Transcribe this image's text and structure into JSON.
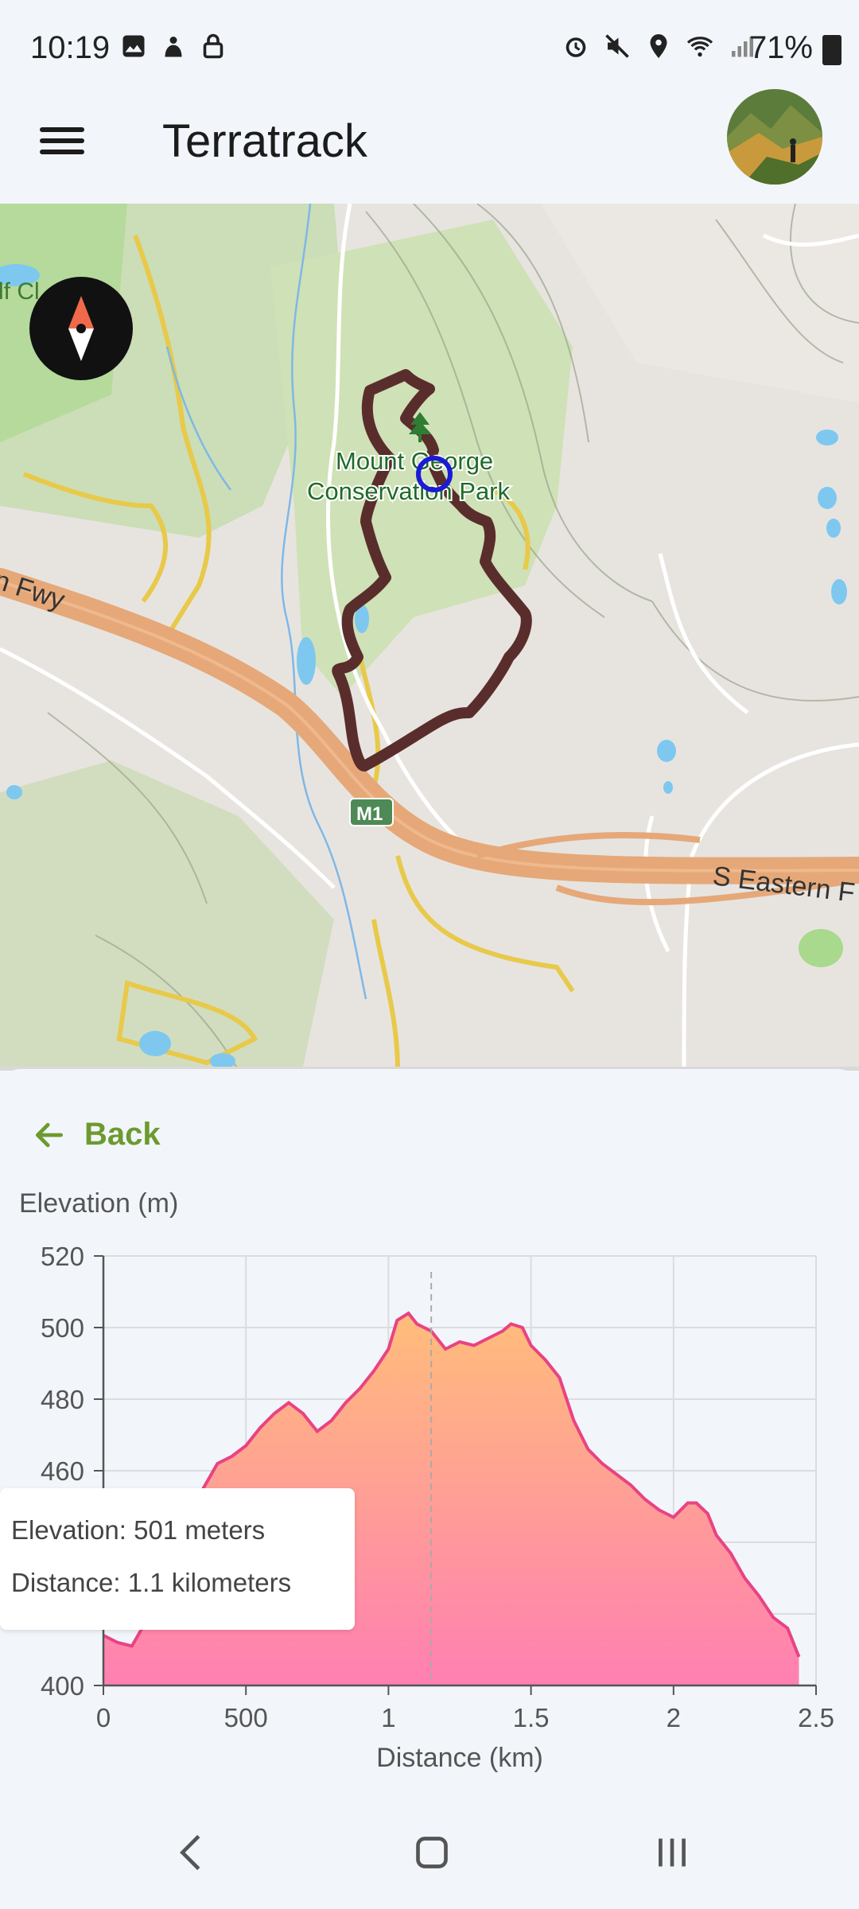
{
  "status_bar": {
    "time": "10:19",
    "battery": "71%",
    "left_icons": [
      "gallery-icon",
      "app-icon",
      "lock-icon"
    ],
    "right_icons": [
      "alarm-icon",
      "mute-icon",
      "location-icon",
      "wifi-icon",
      "signal-icon"
    ]
  },
  "app_bar": {
    "title": "Terratrack",
    "menu_icon": "menu-icon",
    "avatar": "avatar"
  },
  "map": {
    "labels": {
      "park_line1": "Mount George",
      "park_line2": "Conservation Park",
      "freeway_left": "n Fwy",
      "freeway_right": "S Eastern F",
      "road_badge": "M1",
      "corner_label": "lf Cl"
    },
    "colors": {
      "track": "#5a2d2d",
      "freeway": "#e9a978",
      "park": "#b9d89c",
      "position_marker": "#1b1bd6"
    }
  },
  "sheet": {
    "back_label": "Back",
    "tooltip": {
      "elevation": "Elevation: 501 meters",
      "distance": "Distance: 1.1 kilometers"
    }
  },
  "chart_data": {
    "type": "area",
    "ylabel": "Elevation (m)",
    "xlabel": "Distance (km)",
    "xlim": [
      0,
      2.5
    ],
    "ylim": [
      400,
      520
    ],
    "x_ticks": [
      "0",
      "500",
      "1",
      "1.5",
      "2",
      "2.5"
    ],
    "y_ticks": [
      "400",
      "460",
      "480",
      "500",
      "520"
    ],
    "grid": true,
    "cursor_x": 1.15,
    "fill_gradient": [
      "#ffbd7a",
      "#ff7fb2"
    ],
    "line_color": "#e84384",
    "x": [
      0,
      0.05,
      0.1,
      0.15,
      0.2,
      0.25,
      0.3,
      0.35,
      0.4,
      0.45,
      0.5,
      0.55,
      0.6,
      0.65,
      0.7,
      0.75,
      0.8,
      0.85,
      0.9,
      0.95,
      1.0,
      1.03,
      1.07,
      1.1,
      1.15,
      1.2,
      1.25,
      1.3,
      1.35,
      1.4,
      1.43,
      1.47,
      1.5,
      1.55,
      1.6,
      1.65,
      1.7,
      1.75,
      1.8,
      1.85,
      1.9,
      1.95,
      2.0,
      2.05,
      2.08,
      2.12,
      2.15,
      2.2,
      2.25,
      2.3,
      2.35,
      2.4,
      2.44
    ],
    "y": [
      414,
      412,
      411,
      418,
      425,
      433,
      444,
      455,
      462,
      464,
      467,
      472,
      476,
      479,
      476,
      471,
      474,
      479,
      483,
      488,
      494,
      502,
      504,
      501,
      499,
      494,
      496,
      495,
      497,
      499,
      501,
      500,
      495,
      491,
      486,
      474,
      466,
      462,
      459,
      456,
      452,
      449,
      447,
      451,
      451,
      448,
      442,
      437,
      430,
      425,
      419,
      416,
      408
    ]
  },
  "nav_bar": {
    "back": "nav-back-icon",
    "home": "nav-home-icon",
    "recents": "nav-recents-icon"
  }
}
